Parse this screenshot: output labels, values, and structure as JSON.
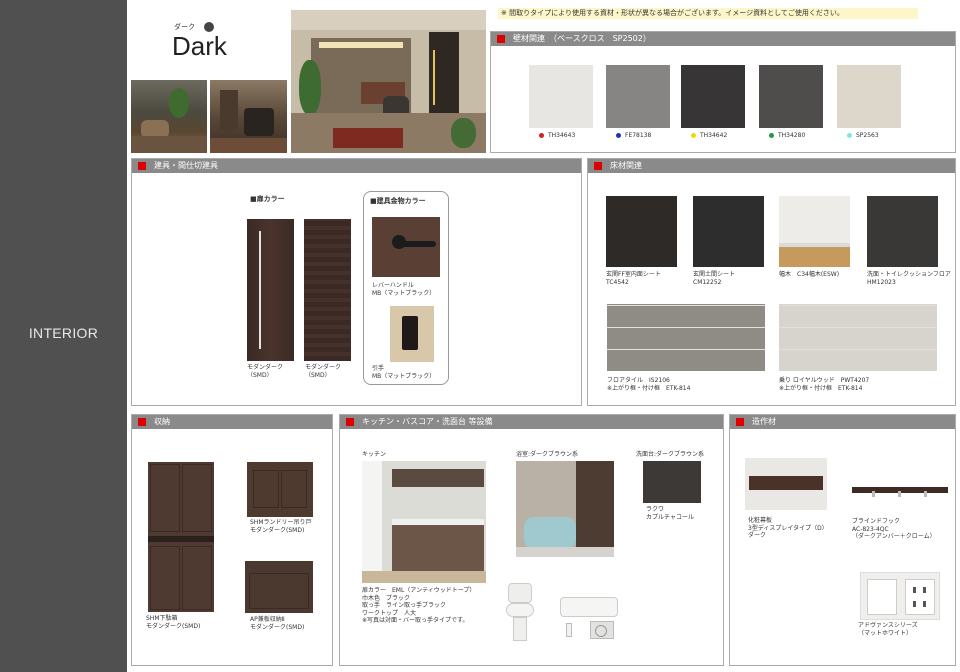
{
  "sidebar": {
    "label": "INTERIOR"
  },
  "brand": {
    "kana": "ダーク",
    "title": "Dark"
  },
  "note": "※ 間取りタイプにより使用する資材・形状が異なる場合がございます。イメージ資料としてご使用ください。",
  "wall": {
    "title": "壁材関連　（ベースクロス　SP2502）",
    "swatches": [
      {
        "code": "TH34643",
        "dot": "#d21f1f",
        "color": "#e8e6e2"
      },
      {
        "code": "FE78138",
        "dot": "#2233bb",
        "color": "#878583"
      },
      {
        "code": "TH34642",
        "dot": "#f3d800",
        "color": "#383536"
      },
      {
        "code": "TH34280",
        "dot": "#229944",
        "color": "#4e4d4b"
      },
      {
        "code": "SP2563",
        "dot": "#7fe5e5",
        "color": "#ddd6ca"
      }
    ]
  },
  "fittings": {
    "title": "建具・間仕切建具",
    "door_heading": "■扉カラー",
    "hardware_heading": "■建具金物カラー",
    "doors": [
      {
        "label": "モダンダーク\n（SMD）"
      },
      {
        "label": "モダンダーク\n（SMD）"
      }
    ],
    "handle_label": "レバーハンドル\nMB（マットブラック）",
    "pull_label": "引手\nMB（マットブラック）"
  },
  "floor": {
    "title": "床材関連",
    "tiles": [
      {
        "label": "玄関FF室内面シート\nTC4542",
        "color": "#2e2a27"
      },
      {
        "label": "玄関土間シート\nCM12252",
        "color": "#2d2d2d"
      },
      {
        "label": "幅木　C34幅木(ESW)",
        "color": "#e9e7e3"
      },
      {
        "label": "洗面・トイレクッションフロア\nHM12023",
        "color": "#3a3837"
      }
    ],
    "planks": [
      {
        "label": "フロアタイル　IS2106\n※上がり框・付け框　ETK-814",
        "color": "#8f8c85"
      },
      {
        "label": "乗り ロイヤルウッド　PWT4207\n※上がり框・付け框　ETK-814",
        "color": "#d7d4cd"
      }
    ]
  },
  "storage": {
    "title": "収納",
    "items": [
      {
        "label": "SHM下駄箱\nモダンダーク(SMD)"
      },
      {
        "label": "SHMランドリー吊り戸\nモダンダーク(SMD)"
      },
      {
        "label": "AP兼板収納Ⅱ\nモダンダーク(SMD)"
      }
    ]
  },
  "kitchen": {
    "title": "キッチン・バスコア・洗面台 等設備",
    "kitchen_label": "キッチン",
    "bath_label": "浴室:ダークブラウン系",
    "vanity_label": "洗面台:ダークブラウン系",
    "vanity_sub": "ラクワ\nカプルチャコール",
    "spec": "扉カラー　EML（アンティウッドトープ）\n巾木色　ブラック\n取っ手　ライン取っ手ブラック\nワークトップ　人大\n※写真は対面・バー取っ手タイプです。"
  },
  "built": {
    "title": "造作材",
    "shelf_label": "化粧幕板\n3型ディスプレイタイプ（D）\nダーク",
    "hook_label": "ブラインドフック\nAC-823-4QC\n（ダークアンバー＋クローム）",
    "outlet_label": "アドヴァンスシリーズ\n（マットホワイト）"
  }
}
